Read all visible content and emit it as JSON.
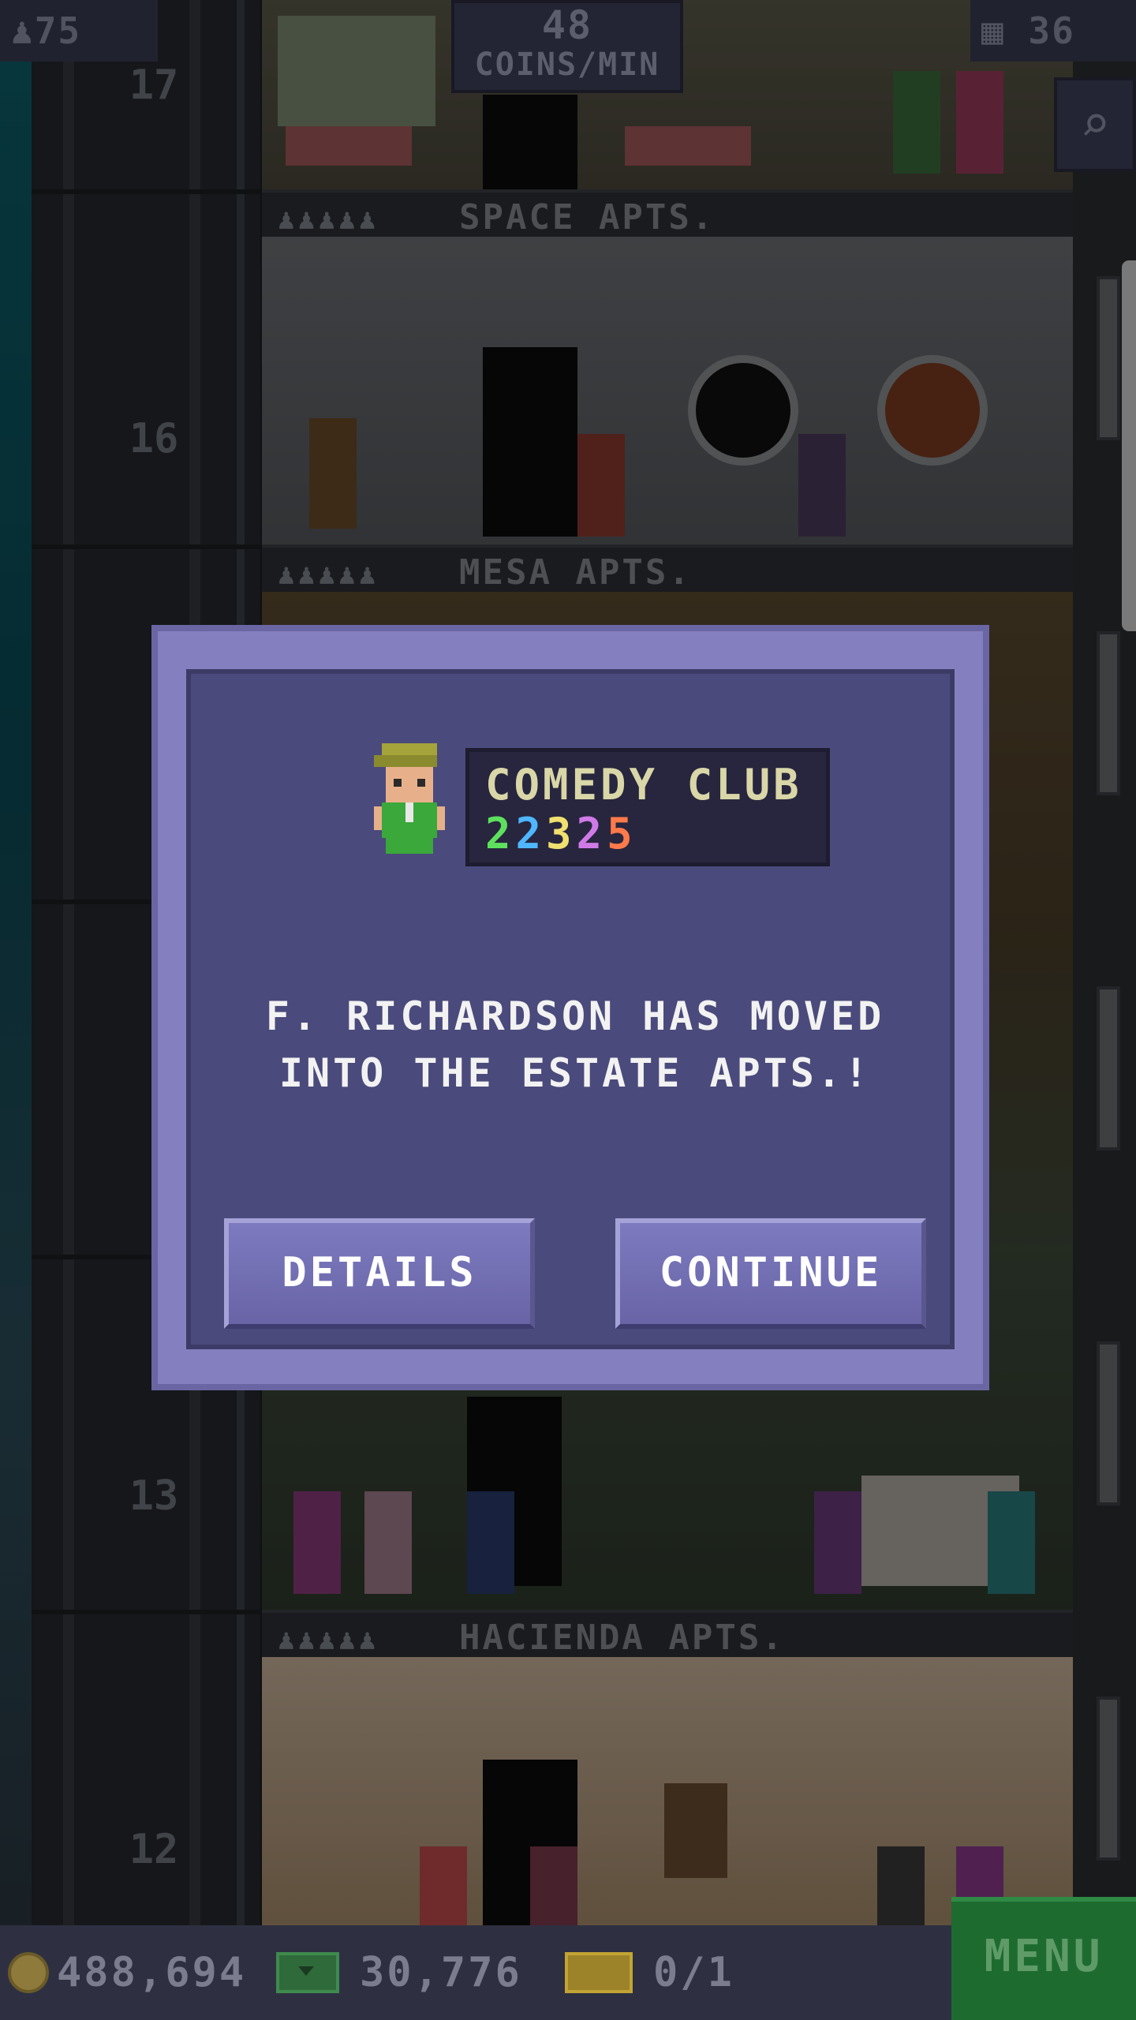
{
  "hud": {
    "population": "75",
    "coins_per_min_value": "48",
    "coins_per_min_label": "COINS/MIN",
    "floors": "36"
  },
  "tower": {
    "floor_numbers": [
      "17",
      "16",
      "13",
      "12"
    ],
    "floor_signs": [
      "SPACE APTS.",
      "MESA APTS.",
      "HACIENDA APTS."
    ]
  },
  "modal": {
    "badge_title": "COMEDY CLUB",
    "badge_digits": [
      {
        "d": "2",
        "color": "#5ee05e"
      },
      {
        "d": "2",
        "color": "#4fb6ff"
      },
      {
        "d": "3",
        "color": "#f0e070"
      },
      {
        "d": "2",
        "color": "#d07ae8"
      },
      {
        "d": "5",
        "color": "#ff7a4a"
      }
    ],
    "message_line1": "F. RICHARDSON HAS MOVED",
    "message_line2": "INTO THE ESTATE APTS.!",
    "details_label": "DETAILS",
    "continue_label": "CONTINUE"
  },
  "bottom": {
    "coins": "488,694",
    "bux": "30,776",
    "tickets": "0/1",
    "menu_label": "MENU"
  },
  "colors": {
    "modal_frame": "#8480c0",
    "modal_inner": "#4b4a7c",
    "button": "#7e7ac0",
    "menu_green": "#1e6b30"
  }
}
